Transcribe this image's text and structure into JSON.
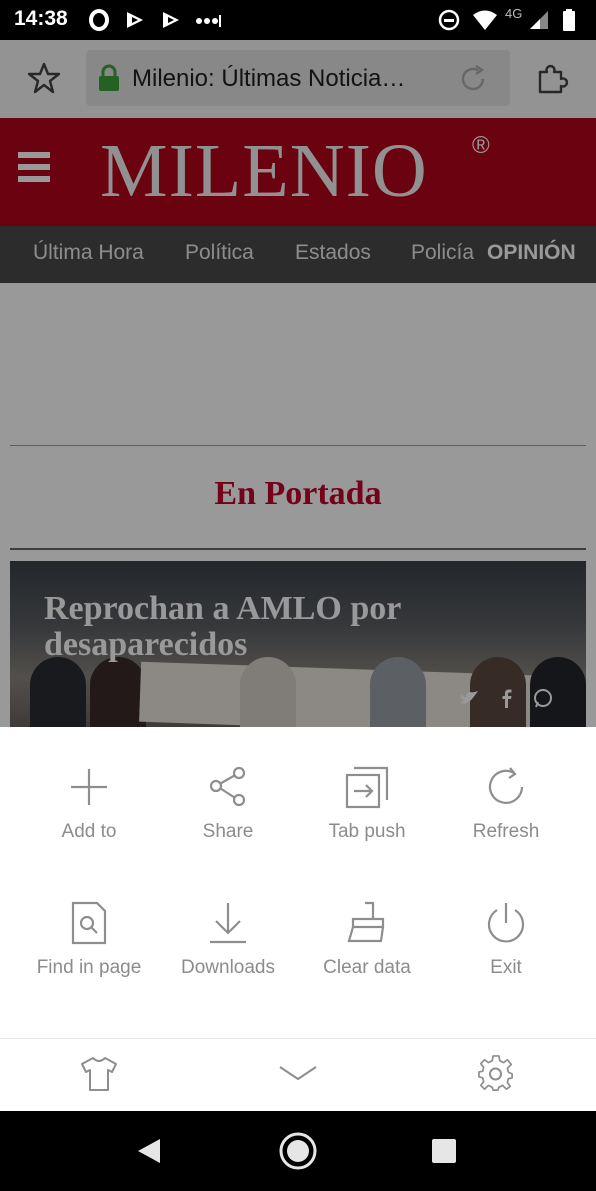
{
  "status_bar": {
    "time": "14:38",
    "network": "4G",
    "icons": [
      "opera-icon",
      "notification-icon",
      "notification-icon",
      "more-dots-icon",
      "dnd-icon",
      "wifi-icon",
      "signal-icon",
      "battery-icon"
    ]
  },
  "browser": {
    "url_title": "Milenio: Últimas Noticia…",
    "icons": [
      "star-icon",
      "lock-icon",
      "reload-icon",
      "extension-icon"
    ]
  },
  "site": {
    "logo": "MILENIO",
    "logo_mark": "®",
    "nav": [
      "Última Hora",
      "Política",
      "Estados",
      "Policía"
    ],
    "nav_highlight": "OPINIÓN",
    "section_title": "En Portada",
    "hero_title": "Reprochan a AMLO por desaparecidos",
    "brand_color": "#b3041c"
  },
  "menu": {
    "items": [
      {
        "label": "Add to",
        "icon": "plus-icon"
      },
      {
        "label": "Share",
        "icon": "share-icon"
      },
      {
        "label": "Tab push",
        "icon": "tab-push-icon"
      },
      {
        "label": "Refresh",
        "icon": "refresh-icon"
      },
      {
        "label": "Find in page",
        "icon": "find-in-page-icon"
      },
      {
        "label": "Downloads",
        "icon": "download-icon"
      },
      {
        "label": "Clear data",
        "icon": "broom-icon"
      },
      {
        "label": "Exit",
        "icon": "power-icon"
      }
    ],
    "bottom_icons": [
      "theme-shirt-icon",
      "collapse-chevron-icon",
      "settings-gear-icon"
    ]
  },
  "system_nav": [
    "back-icon",
    "home-icon",
    "recents-icon"
  ]
}
